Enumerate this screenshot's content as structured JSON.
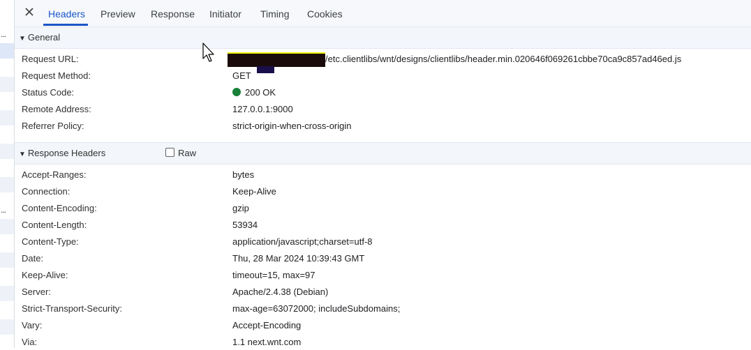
{
  "tabs": [
    {
      "label": "Headers"
    },
    {
      "label": "Preview"
    },
    {
      "label": "Response"
    },
    {
      "label": "Initiator"
    },
    {
      "label": "Timing"
    },
    {
      "label": "Cookies"
    }
  ],
  "general": {
    "title": "General",
    "rows": [
      {
        "key": "Request URL:",
        "value": "/etc.clientlibs/wnt/designs/clientlibs/header.min.020646f069261cbbe70ca9c857ad46ed.js"
      },
      {
        "key": "Request Method:",
        "value": "GET"
      },
      {
        "key": "Status Code:",
        "value": "200 OK"
      },
      {
        "key": "Remote Address:",
        "value": "127.0.0.1:9000"
      },
      {
        "key": "Referrer Policy:",
        "value": "strict-origin-when-cross-origin"
      }
    ]
  },
  "response_headers": {
    "title": "Response Headers",
    "raw_label": "Raw",
    "rows": [
      {
        "key": "Accept-Ranges:",
        "value": "bytes"
      },
      {
        "key": "Connection:",
        "value": "Keep-Alive"
      },
      {
        "key": "Content-Encoding:",
        "value": "gzip"
      },
      {
        "key": "Content-Length:",
        "value": "53934"
      },
      {
        "key": "Content-Type:",
        "value": "application/javascript;charset=utf-8"
      },
      {
        "key": "Date:",
        "value": "Thu, 28 Mar 2024 10:39:43 GMT"
      },
      {
        "key": "Keep-Alive:",
        "value": "timeout=15, max=97"
      },
      {
        "key": "Server:",
        "value": "Apache/2.4.38 (Debian)"
      },
      {
        "key": "Strict-Transport-Security:",
        "value": "max-age=63072000; includeSubdomains;"
      },
      {
        "key": "Vary:",
        "value": "Accept-Encoding"
      },
      {
        "key": "Via:",
        "value": "1.1 next.wnt.com"
      }
    ]
  },
  "left_strip": {
    "dots": "..."
  },
  "colors": {
    "accent": "#1a56c8",
    "status_ok": "#188038"
  }
}
